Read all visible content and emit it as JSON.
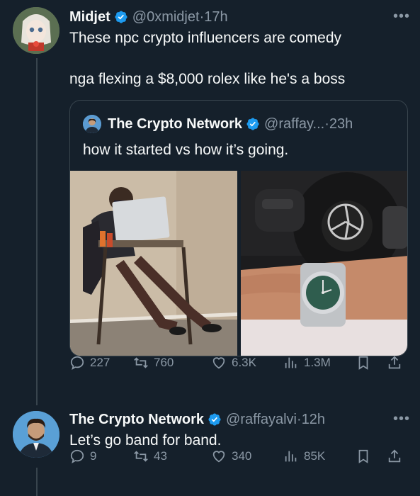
{
  "tweet1": {
    "name": "Midjet",
    "handle": "@0xmidjet",
    "time": "17h",
    "more": "•••",
    "text_line1": "These npc crypto influencers are comedy",
    "text_line2": "nga flexing a $8,000 rolex like he's a boss",
    "quote": {
      "name": "The Crypto Network",
      "handle": "@raffay...",
      "time": "23h",
      "text": "how it started vs how it’s going."
    },
    "actions": {
      "replies": "227",
      "reposts": "760",
      "likes": "6.3K",
      "views": "1.3M"
    }
  },
  "tweet2": {
    "name": "The Crypto Network",
    "handle": "@raffayalvi",
    "time": "12h",
    "more": "•••",
    "text": "Let’s go band for band.",
    "actions": {
      "replies": "9",
      "reposts": "43",
      "likes": "340",
      "views": "85K"
    }
  },
  "colors": {
    "background": "#15202b",
    "verified": "#1d9bf0",
    "muted": "#8b98a5",
    "border": "#38444d"
  }
}
